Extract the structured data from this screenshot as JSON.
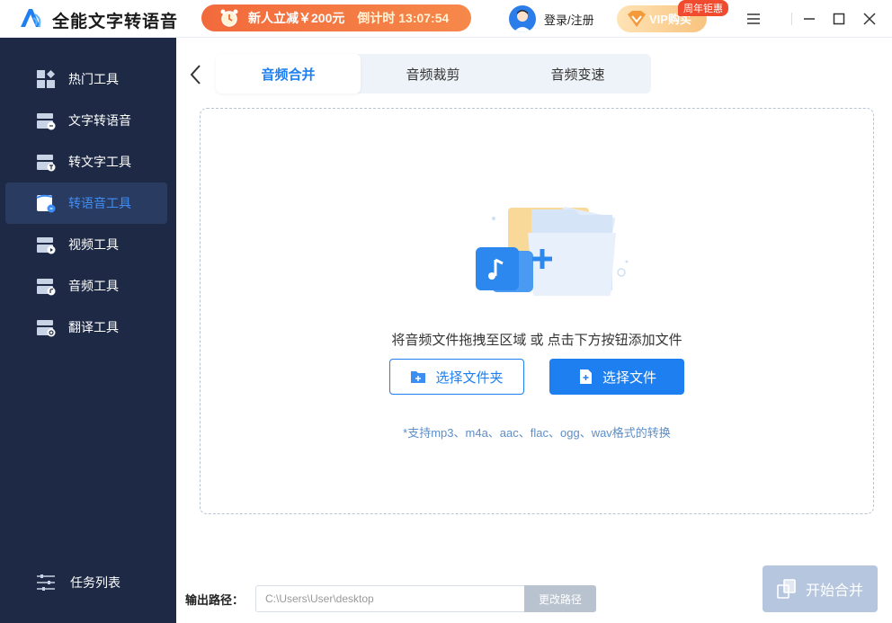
{
  "app": {
    "title": "全能文字转语音"
  },
  "promo": {
    "text": "新人立减￥200元",
    "countdown": "倒计时 13:07:54"
  },
  "header": {
    "login": "登录/注册",
    "vip_label": "VIP购买",
    "vip_badge": "周年钜惠"
  },
  "sidebar": {
    "items": [
      {
        "label": "热门工具",
        "icon": "grid-icon"
      },
      {
        "label": "文字转语音",
        "icon": "text-to-speech-icon"
      },
      {
        "label": "转文字工具",
        "icon": "to-text-icon"
      },
      {
        "label": "转语音工具",
        "icon": "to-speech-icon",
        "active": true
      },
      {
        "label": "视频工具",
        "icon": "video-icon"
      },
      {
        "label": "音频工具",
        "icon": "audio-icon"
      },
      {
        "label": "翻译工具",
        "icon": "translate-icon"
      }
    ],
    "task_list": "任务列表"
  },
  "tabs": [
    {
      "label": "音频合并",
      "active": true
    },
    {
      "label": "音频裁剪"
    },
    {
      "label": "音频变速"
    }
  ],
  "dropzone": {
    "hint": "将音频文件拖拽至区域 或 点击下方按钮添加文件",
    "folder_button": "选择文件夹",
    "file_button": "选择文件",
    "support_note": "*支持mp3、m4a、aac、flac、ogg、wav格式的转换"
  },
  "footer": {
    "output_label": "输出路径：",
    "output_path": "C:\\Users\\User\\desktop",
    "change_path": "更改路径",
    "start_button": "开始合并"
  },
  "colors": {
    "accent": "#1e7ff0",
    "sidebar_bg": "#1e2a45",
    "promo": "#f26a3c",
    "disabled": "#b6c6de"
  }
}
